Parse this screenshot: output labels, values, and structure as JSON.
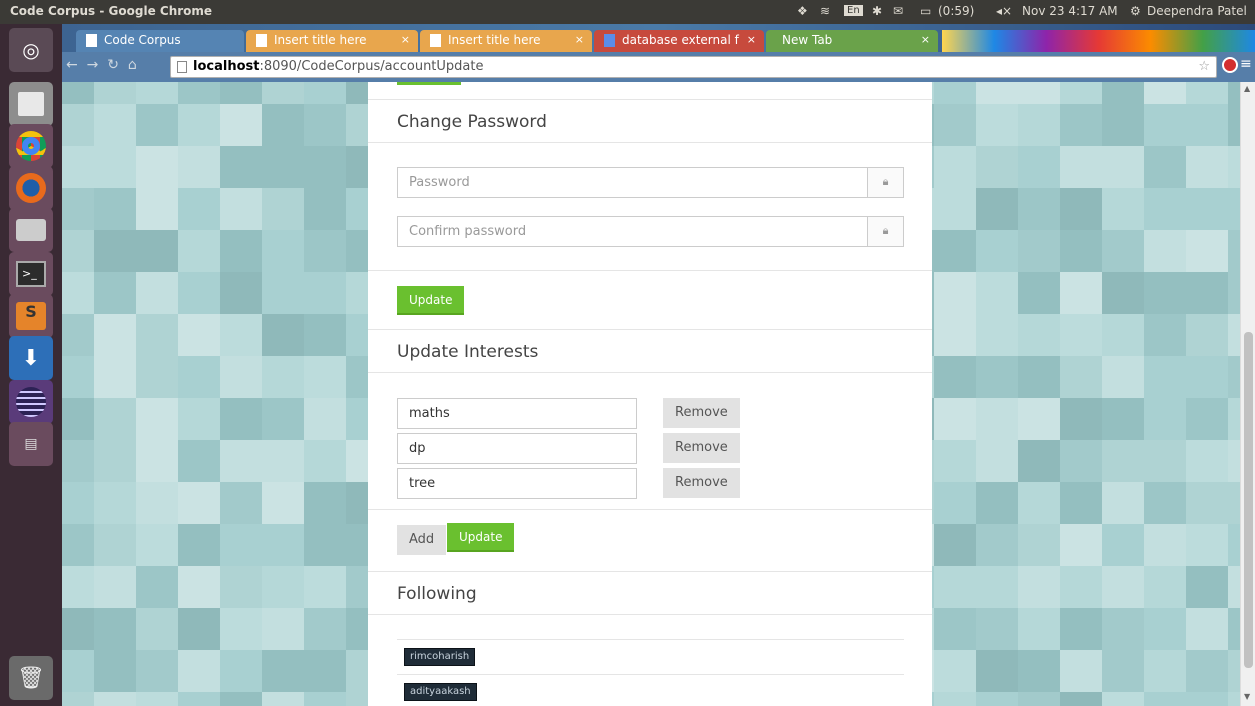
{
  "system": {
    "window_title": "Code Corpus - Google Chrome",
    "language_indicator": "En",
    "battery_text": "(0:59)",
    "datetime": "Nov 23 4:17 AM",
    "user": "Deependra Patel"
  },
  "browser": {
    "tabs": [
      {
        "label": "Code Corpus"
      },
      {
        "label": "Insert title here"
      },
      {
        "label": "Insert title here"
      },
      {
        "label": "database external f"
      },
      {
        "label": "New Tab"
      }
    ],
    "url_host": "localhost",
    "url_path": ":8090/CodeCorpus/accountUpdate"
  },
  "change_password": {
    "title": "Change Password",
    "password_placeholder": "Password",
    "confirm_placeholder": "Confirm password",
    "update_label": "Update"
  },
  "interests": {
    "title": "Update Interests",
    "items": [
      {
        "value": "maths",
        "remove_label": "Remove"
      },
      {
        "value": "dp",
        "remove_label": "Remove"
      },
      {
        "value": "tree",
        "remove_label": "Remove"
      }
    ],
    "add_label": "Add",
    "update_label": "Update"
  },
  "following": {
    "title": "Following",
    "users": [
      "rimcoharish",
      "adityaakash"
    ]
  }
}
